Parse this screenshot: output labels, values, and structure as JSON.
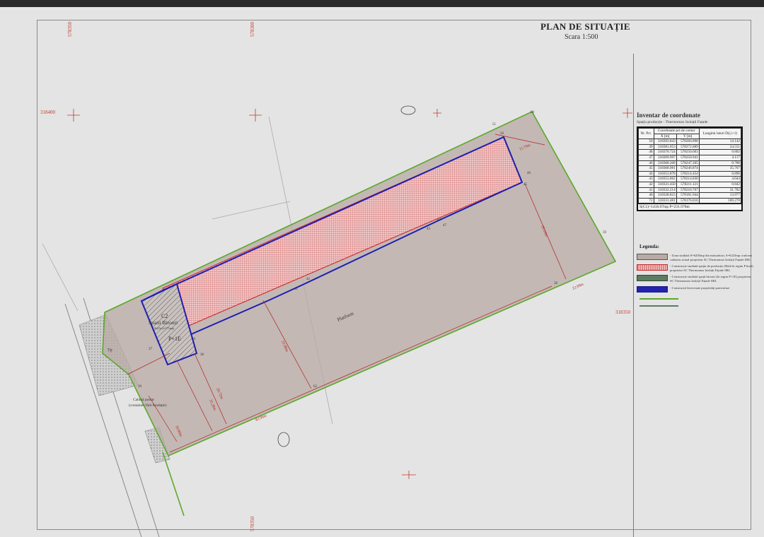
{
  "title": "PLAN DE SITUAȚIE",
  "scale": "Scara 1:500",
  "colors": {
    "parcel_fill": "#b8aaa4",
    "boundary_green": "#5aa82a",
    "hall_red": "#cc2222",
    "building_blue": "#1e1eb0",
    "dimension_red": "#b22222"
  },
  "grid_labels": {
    "left_x": "318400",
    "right_x": "318350",
    "top_y1": "578350",
    "top_y2": "578300",
    "bottom_y": "578350"
  },
  "plan": {
    "c2_label": "C2",
    "c2_name": "Spatii Birouri",
    "c2_area": "Sc(Ac)=171mp",
    "c2_height": "P+1E",
    "platform_label": "Platform",
    "tp_label": "Tp",
    "gatehouse_label": "Cabină portar",
    "gatehouse_sub": "(container fără fundație)",
    "dim_bottom": "82.96m",
    "dim_right": "22.99m",
    "dim_top_right": "11.70m",
    "dim_right_vertical": "35.14m",
    "dim_middle": "21.98m",
    "dim_left1": "20.72m",
    "dim_left2": "31.28m",
    "dim_gate": "10.80m"
  },
  "table": {
    "header_text": "Inventar de coordonate",
    "subtitle": "Spațiu producție - Thermomax Izolații Fațade",
    "columns": {
      "nr": "Nr. Pct.",
      "coords": "Coordonate pct.de contur",
      "x": "X [m]",
      "y": "Y [m]",
      "len": "Lungimi laturi D(i,i+1)"
    },
    "rows": [
      [
        "50",
        "318393.843",
        "578266.898",
        "14.142"
      ],
      [
        "49",
        "318381.053",
        "578272.889",
        "24.551"
      ],
      [
        "48",
        "318370.724",
        "578250.603",
        "0.802"
      ],
      [
        "47",
        "318369.997",
        "578250.941",
        "4.117"
      ],
      [
        "46",
        "318368.268",
        "578247.205",
        "0.786"
      ],
      [
        "45",
        "318368.981",
        "578246.874",
        "35.767"
      ],
      [
        "44",
        "318353.878",
        "578214.454",
        "0.896"
      ],
      [
        "43",
        "318353.062",
        "578214.830",
        "4.044"
      ],
      [
        "42",
        "318331.450",
        "578211.121",
        "0.842"
      ],
      [
        "41",
        "318332.214",
        "578210.767",
        "31.782"
      ],
      [
        "40",
        "318338.823",
        "578181.944",
        "13.977"
      ],
      [
        "72",
        "318331.481",
        "578176.016",
        "100.270"
      ]
    ],
    "footnote": "S(C1)=1416.07mp  P=231.978m"
  },
  "legend": {
    "title": "Legenda:",
    "items": [
      {
        "id": "study-zone",
        "text": "- Zona studiată S=6205mp din măsurători, S=6223mp conform cadastru actual proprietar SC Thermomax Izolații Fațade SRL"
      },
      {
        "id": "hall",
        "text": "- Construcție studiată spațiu de producție (Hală în regim P înalt) proprietar SC Thermomax Izolații Fațade SRL"
      },
      {
        "id": "office",
        "text": "- Construcție studiată spații birouri (în regim P+1E) proprietar SC Thermomax Izolații Fațade SRL"
      },
      {
        "id": "existing",
        "text": "- Construcții învecinate proprietăți particulare"
      }
    ]
  }
}
